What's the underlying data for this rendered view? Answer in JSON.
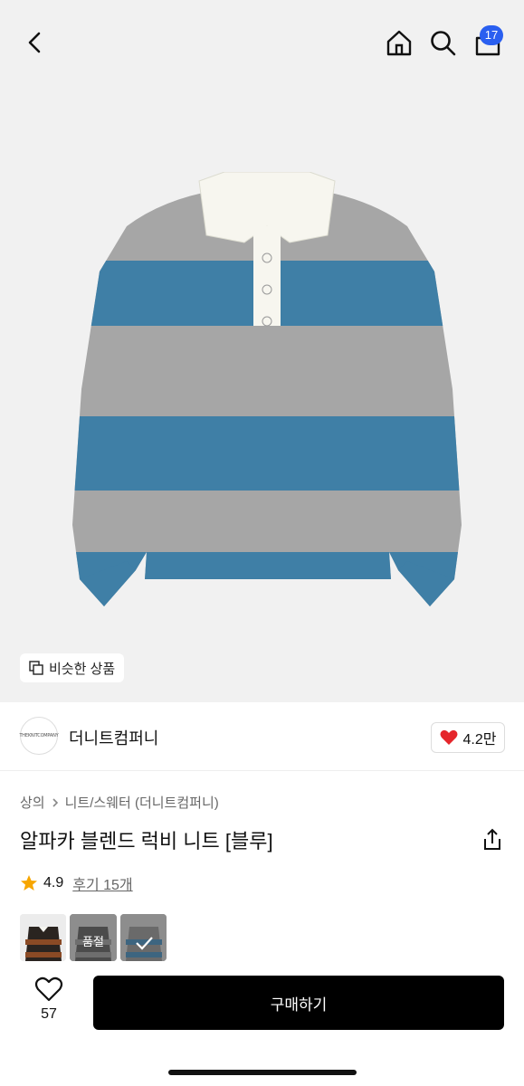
{
  "header": {
    "cart_count": "17"
  },
  "hero": {
    "similar_label": "비슷한 상품"
  },
  "brand": {
    "logo_text": "THEKNITCOMPANY",
    "name": "더니트컴퍼니",
    "likes": "4.2만"
  },
  "product": {
    "breadcrumb": [
      "상의",
      "니트/스웨터 (더니트컴퍼니)"
    ],
    "title": "알파카 블렌드 럭비 니트 [블루]",
    "rating": "4.9",
    "review_label": "후기 15개"
  },
  "options": [
    {
      "name": "brown",
      "label": ""
    },
    {
      "name": "gray",
      "label": "품절"
    },
    {
      "name": "blue",
      "label": ""
    }
  ],
  "bottom": {
    "heart_count": "57",
    "buy_label": "구매하기"
  },
  "colors": {
    "accent_blue": "#2a5ff0",
    "stripe_blue": "#3f7fa6",
    "stripe_gray": "#a6a6a6",
    "heart_red": "#e5262b",
    "star_yellow": "#f7a600"
  }
}
